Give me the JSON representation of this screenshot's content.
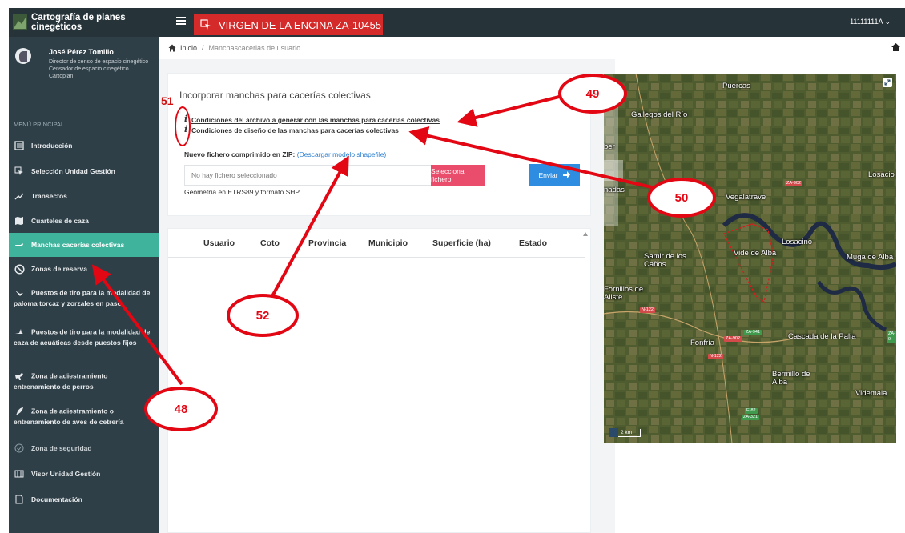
{
  "app": {
    "title": "Cartografía de planes cinegéticos",
    "unit_badge": "VIRGEN DE LA ENCINA ZA-10455",
    "user_code": "11111111A ⌄"
  },
  "user": {
    "name": "José Pérez Tomillo",
    "roles": [
      "Director de censo de espacio cinegético",
      "Censador de espacio cinegético",
      "Cartoplan"
    ]
  },
  "sidebar": {
    "section_title": "MENÚ PRINCIPAL",
    "items": [
      {
        "label": "Introducción",
        "icon": "list-icon"
      },
      {
        "label": "Selección Unidad Gestión",
        "icon": "cursor-select-icon"
      },
      {
        "label": "Transectos",
        "icon": "trend-icon"
      },
      {
        "label": "Cuarteles de caza",
        "icon": "map-icon"
      },
      {
        "label": "Manchas cacerías colectivas",
        "icon": "dog-icon",
        "active": true
      },
      {
        "label": "Zonas de reserva",
        "icon": "ban-icon"
      },
      {
        "label": "Puestos de tiro para la modalidad de paloma torcaz y zorzales en paso",
        "icon": "bird-icon"
      },
      {
        "label": "Puestos de tiro para la modalidad de caza de acuáticas desde puestos fijos",
        "icon": "duck-icon"
      },
      {
        "label": "Zona de adiestramiento entrenamiento de perros",
        "icon": "running-dog-icon"
      },
      {
        "label": "Zona de adiestramiento o entrenamiento de aves de cetrería",
        "icon": "feather-icon"
      },
      {
        "label": "Zona de seguridad",
        "icon": "check-circle-icon"
      },
      {
        "label": "Visor Unidad Gestión",
        "icon": "book-icon"
      },
      {
        "label": "Documentación",
        "icon": "document-icon"
      }
    ]
  },
  "breadcrumb": {
    "home": "Inicio",
    "separator": "/",
    "current": "Manchascacerias de usuario"
  },
  "form": {
    "title": "Incorporar manchas para cacerías colectivas",
    "condition_1": "Condiciones del archivo a generar con las manchas para cacerías colectivas",
    "condition_2": "Condiciones de diseño de las manchas para cacerías colectivas",
    "upload_label": "Nuevo fichero comprimido en ZIP:",
    "download_link": "(Descargar modelo shapefile)",
    "file_placeholder": "No hay fichero seleccionado",
    "select_button": "Selecciona fichero",
    "send_button": "Enviar",
    "geometry_note": "Geometría en ETRS89 y formato SHP"
  },
  "table": {
    "columns": [
      "Usuario",
      "Coto",
      "Provincia",
      "Municipio",
      "Superficie (ha)",
      "Estado"
    ],
    "rows": []
  },
  "map": {
    "places": [
      "Puercas",
      "Gallegos del Río",
      "Losacio",
      "Vegalatrave",
      "Losacino",
      "Samir de los Caños",
      "Vide de Alba",
      "Muga de Alba",
      "Fornillos de Aliste",
      "Fonfría",
      "Cascada de la Palia",
      "Bermillo de Alba",
      "Videmala",
      "ber",
      "nadas"
    ],
    "roads": [
      "ZA-902",
      "N-122",
      "ZA-941",
      "ZA-902",
      "N-122",
      "E-82",
      "ZA-321",
      "ZA-9"
    ],
    "scale": "2 km"
  },
  "annotations": {
    "a48": "48",
    "a49": "49",
    "a50": "50",
    "a51": "51",
    "a52": "52",
    "color": "#e30613"
  },
  "colors": {
    "sidebar": "#2f3f47",
    "active": "#3fb39b",
    "unit_badge": "#d42a2a",
    "select_button": "#ea4d6c",
    "send_button": "#2e8de0"
  }
}
